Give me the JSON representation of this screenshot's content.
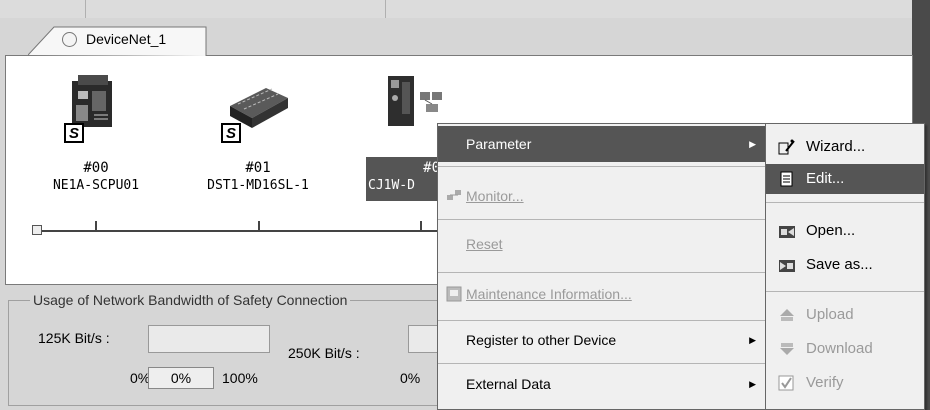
{
  "tab": {
    "label": "DeviceNet_1"
  },
  "devices": [
    {
      "number": "#00",
      "name": "NE1A-SCPU01",
      "safety_badge": "S",
      "icon": "safety-controller-icon"
    },
    {
      "number": "#01",
      "name": "DST1-MD16SL-1",
      "safety_badge": "S",
      "icon": "safety-io-terminal-icon"
    },
    {
      "number": "#0",
      "name": "CJ1W-D",
      "icon": "cj1w-unit-icon",
      "selected": true
    }
  ],
  "bandwidth": {
    "title": "Usage of Network Bandwidth of Safety Connection",
    "rate1_label": "125K Bit/s :",
    "rate2_label": "250K Bit/s :",
    "min1": "0%",
    "current1": "0%",
    "max1": "100%",
    "min2": "0%"
  },
  "context_menu": {
    "items": [
      {
        "label": "Parameter",
        "enabled": true,
        "highlighted": true,
        "has_submenu": true
      },
      {
        "label": "Monitor...",
        "enabled": false,
        "icon": "monitor-icon"
      },
      {
        "label": "Reset",
        "enabled": false
      },
      {
        "label": "Maintenance Information...",
        "enabled": false,
        "icon": "maintenance-icon"
      },
      {
        "label": "Register to other Device",
        "enabled": true,
        "has_submenu": true
      },
      {
        "label": "External Data",
        "enabled": true,
        "has_submenu": true
      }
    ]
  },
  "submenu": {
    "items": [
      {
        "label": "Wizard...",
        "enabled": true,
        "icon": "wizard-icon"
      },
      {
        "label": "Edit...",
        "enabled": true,
        "highlighted": true,
        "icon": "edit-icon"
      },
      {
        "label": "Open...",
        "enabled": true,
        "icon": "open-icon"
      },
      {
        "label": "Save as...",
        "enabled": true,
        "icon": "save-as-icon"
      },
      {
        "label": "Upload",
        "enabled": false,
        "icon": "upload-icon"
      },
      {
        "label": "Download",
        "enabled": false,
        "icon": "download-icon"
      },
      {
        "label": "Verify",
        "enabled": false,
        "icon": "verify-icon"
      }
    ]
  },
  "colors": {
    "highlight": "#555555",
    "disabled_text": "#9a9a9a",
    "menu_bg": "#f0f0f0"
  }
}
